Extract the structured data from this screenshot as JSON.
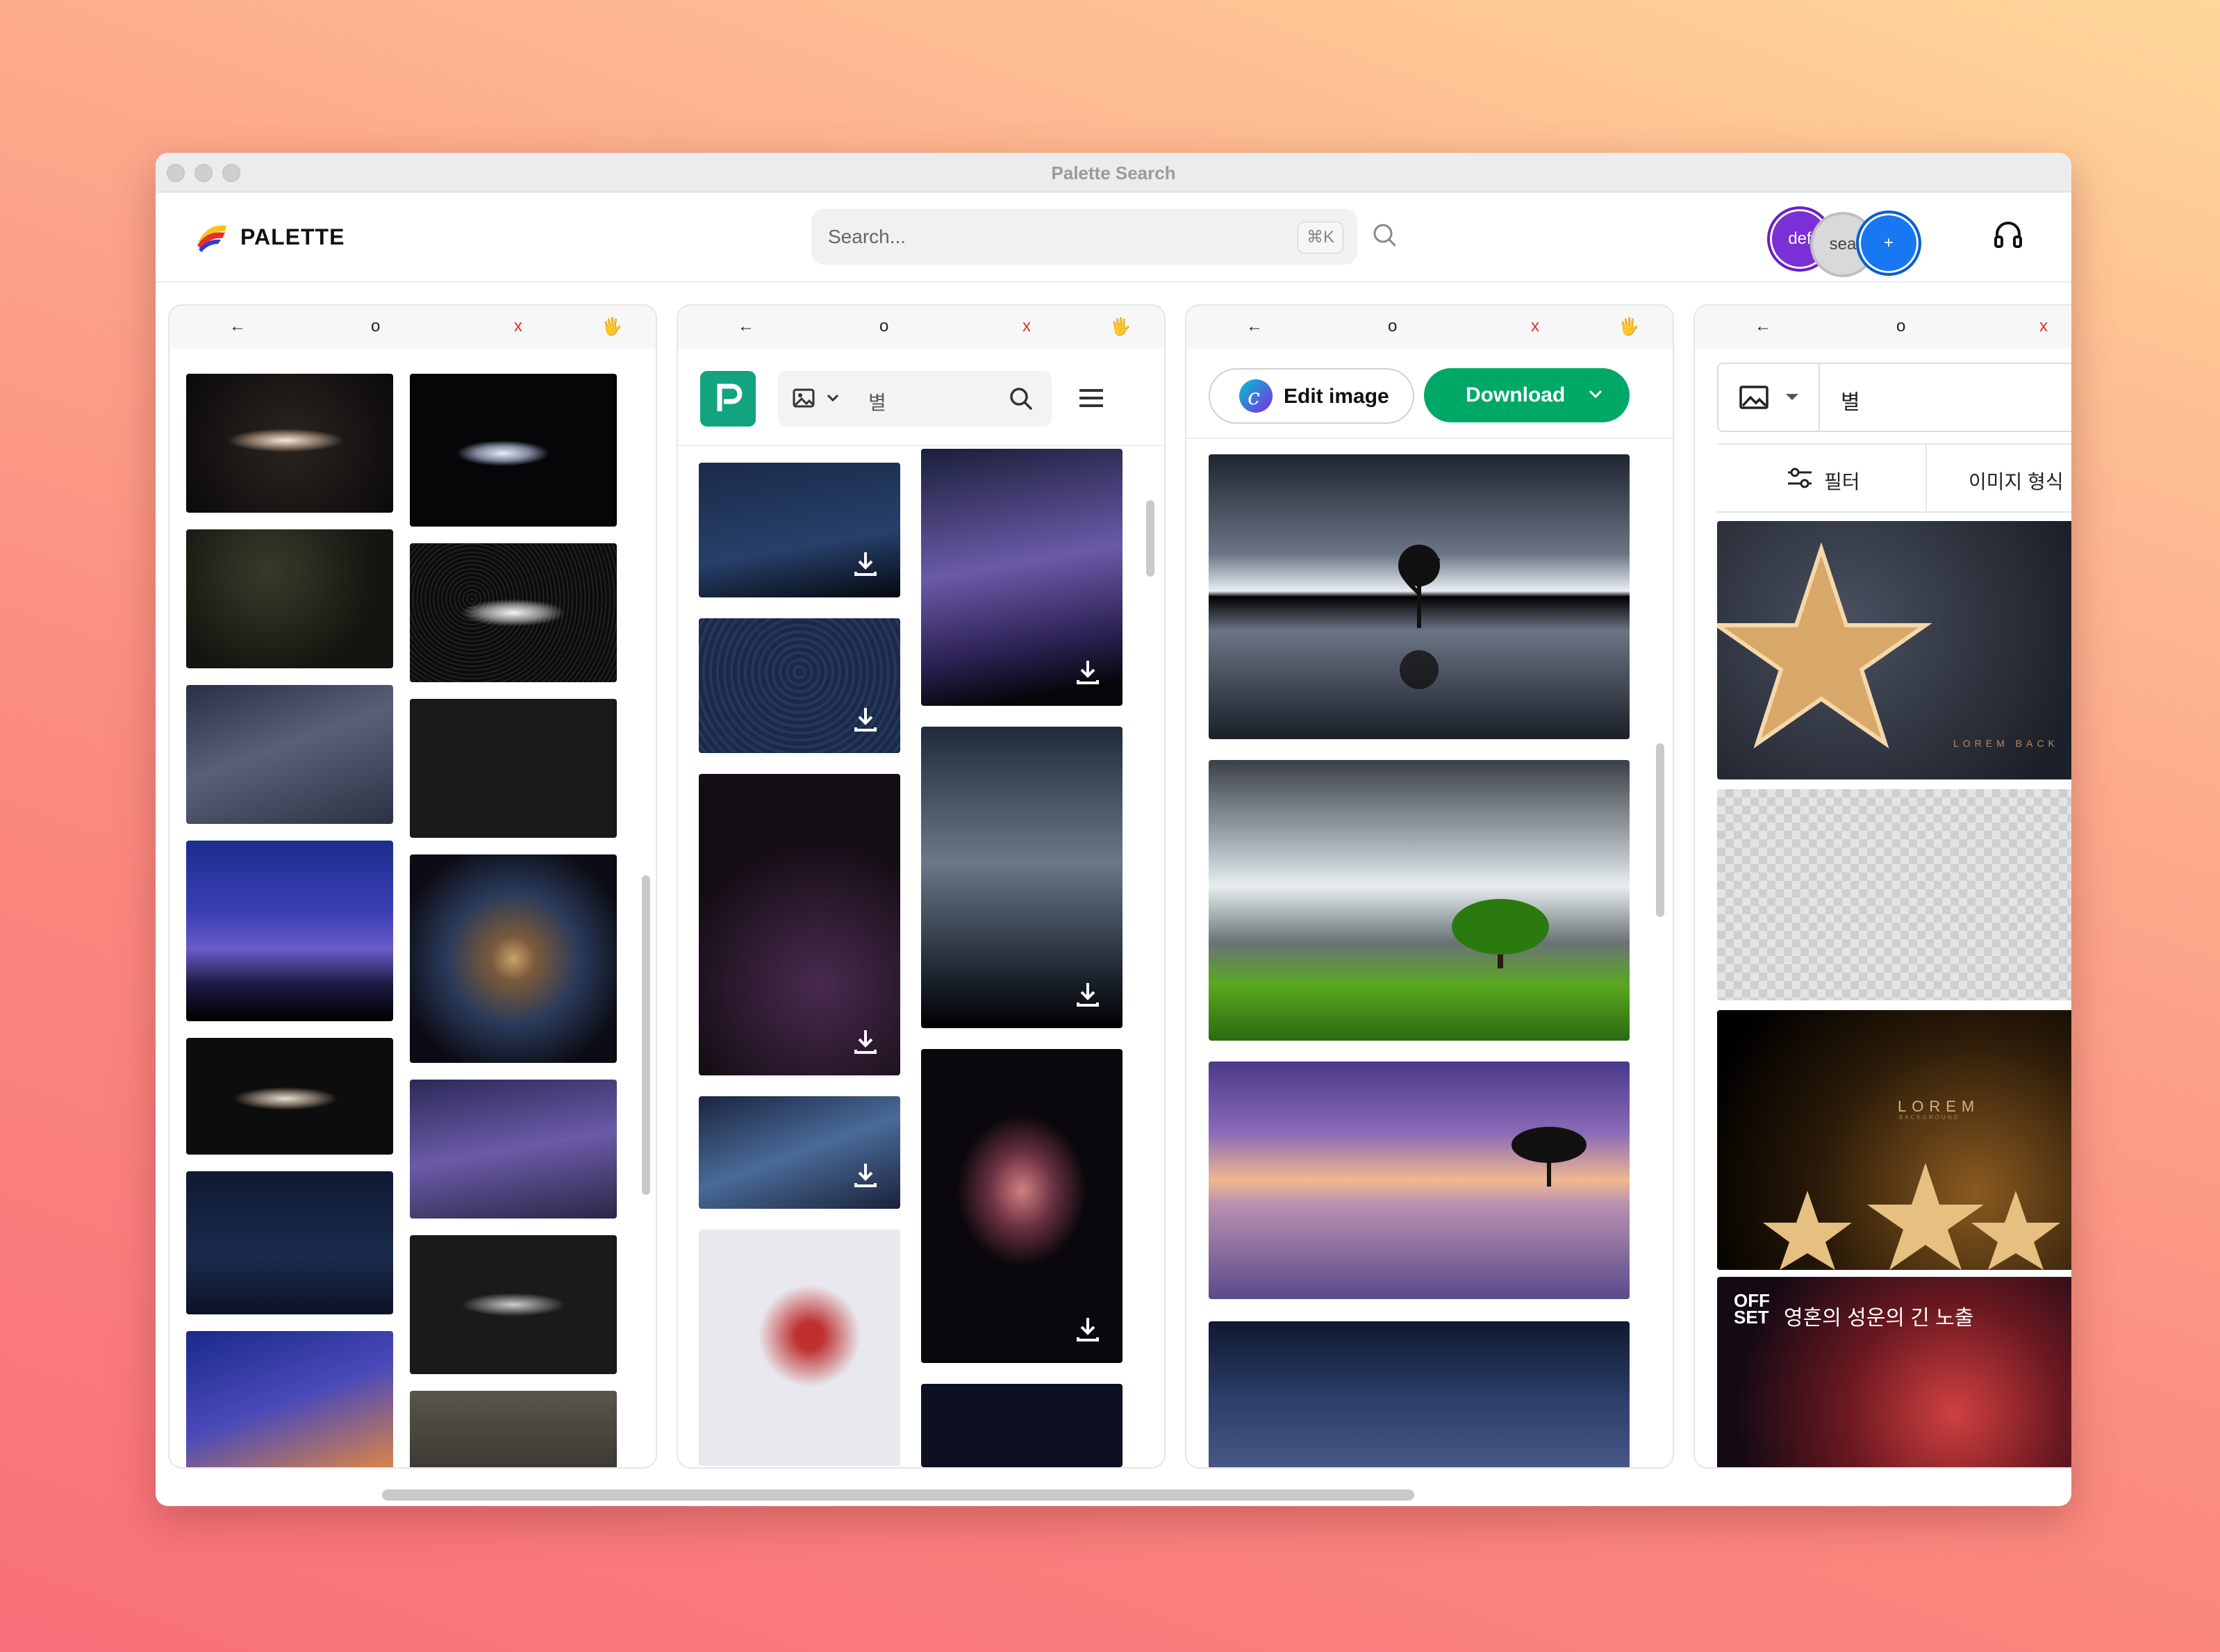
{
  "window": {
    "title": "Palette Search"
  },
  "header": {
    "logo_text": "PALETTE",
    "search_placeholder": "Search...",
    "search_shortcut": "⌘K",
    "avatars": [
      "def",
      "sea",
      "+"
    ]
  },
  "panel_controls": {
    "back": "←",
    "refresh": "o",
    "close": "x",
    "drag": "🖐"
  },
  "panel2": {
    "query": "별"
  },
  "panel3": {
    "edit_label": "Edit image",
    "download_label": "Download"
  },
  "panel4": {
    "query": "별",
    "filter_label": "필터",
    "type_label": "이미지 형식",
    "card_caption": "영혼의 성운의 긴 노출",
    "card_badge_top": "OFF",
    "card_badge_bottom": "SET",
    "lorem_text": "LOREM",
    "lorem_sub": "BACKGROUND",
    "lorem_text2": "LOREM BACK"
  },
  "colors": {
    "accent_green": "#00a868",
    "palette_green": "#12a37f",
    "avatar_purple": "#7b2fd6",
    "avatar_blue": "#1877f2",
    "close_red": "#e0312c"
  },
  "icons": [
    "search-icon",
    "headset-icon",
    "download-icon",
    "image-icon",
    "chevron-down-icon",
    "hamburger-menu-icon",
    "filter-sliders-icon",
    "canva-icon"
  ]
}
